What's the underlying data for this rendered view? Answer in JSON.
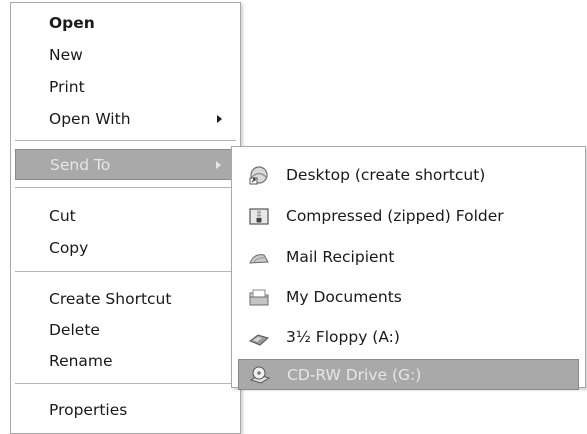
{
  "context_menu": {
    "items": [
      {
        "label": "Open"
      },
      {
        "label": "New"
      },
      {
        "label": "Print"
      },
      {
        "label": "Open With"
      },
      {
        "label": "Send To"
      },
      {
        "label": "Cut"
      },
      {
        "label": "Copy"
      },
      {
        "label": "Create Shortcut"
      },
      {
        "label": "Delete"
      },
      {
        "label": "Rename"
      },
      {
        "label": "Properties"
      }
    ]
  },
  "send_to_menu": {
    "items": [
      {
        "label": "Desktop (create shortcut)",
        "icon": "desktop-icon"
      },
      {
        "label": "Compressed (zipped) Folder",
        "icon": "zip-folder-icon"
      },
      {
        "label": "Mail Recipient",
        "icon": "mail-icon"
      },
      {
        "label": "My Documents",
        "icon": "my-documents-icon"
      },
      {
        "label": "3½ Floppy (A:)",
        "icon": "floppy-icon"
      },
      {
        "label": "CD-RW Drive (G:)",
        "icon": "cd-drive-icon"
      }
    ]
  },
  "colors": {
    "highlight": "#a9a9a9",
    "separator": "#b6b6b6"
  }
}
